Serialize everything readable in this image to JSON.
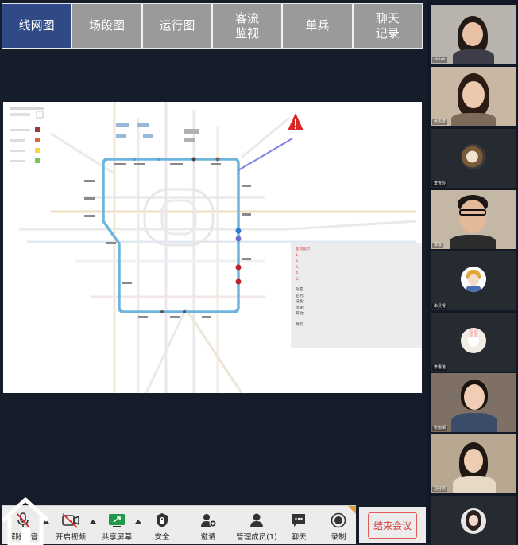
{
  "tabs": [
    {
      "label": "线网图",
      "active": true
    },
    {
      "label": "场段图",
      "active": false
    },
    {
      "label": "运行图",
      "active": false
    },
    {
      "label": "客流\n监视",
      "active": false
    },
    {
      "label": "单兵",
      "active": false
    },
    {
      "label": "聊天\n记录",
      "active": false
    }
  ],
  "annotation": {
    "red_lines": [
      "客流提示：",
      "1.",
      "2.",
      "3.",
      "4.",
      "5."
    ],
    "black_lines": [
      "处置",
      "业务：",
      "设备：",
      "措施：",
      "其他：",
      "预案"
    ]
  },
  "participants": [
    {
      "name": "sivian"
    },
    {
      "name": "张思梦"
    },
    {
      "name": "李雪玲"
    },
    {
      "name": "覃骏"
    },
    {
      "name": "朱昊睿"
    },
    {
      "name": "李惠凌"
    },
    {
      "name": "张雨晴"
    },
    {
      "name": "胡佳颖"
    },
    {
      "name": ""
    }
  ],
  "toolbar": {
    "mute_label": "解除静音",
    "video_label": "开启视频",
    "share_label": "共享屏幕",
    "security_label": "安全",
    "invite_label": "邀请",
    "manage_label": "管理成员(1)",
    "chat_label": "聊天",
    "record_label": "录制"
  },
  "end_meeting_label": "结束会议",
  "colors": {
    "active_tab": "#2f4a86",
    "inactive_tab": "#9a9a9a",
    "loop_line": "#6eb5de",
    "end_button": "#d83a3a"
  }
}
